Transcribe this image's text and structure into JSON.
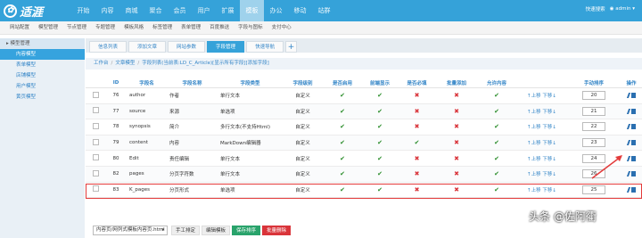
{
  "logo": {
    "text": "适涯"
  },
  "topnav": [
    "开始",
    "内容",
    "商城",
    "聚合",
    "会员",
    "用户",
    "扩展",
    "模板",
    "办公",
    "移动",
    "站群"
  ],
  "topnav_active": 7,
  "topright": {
    "quick": "快速搜索",
    "user": "admin"
  },
  "subbar": [
    "网站配置",
    "模型管理",
    "节点管理",
    "专题管理",
    "模板风格",
    "标签管理",
    "表单管理",
    "百度推送",
    "字段与图标",
    "支付中心"
  ],
  "sidebar": {
    "head": "模型管理",
    "items": [
      "内容模型",
      "表单模型",
      "店铺模型",
      "用户模型",
      "黄页模型"
    ],
    "active": 0
  },
  "tabs": [
    "信息列表",
    "添加文章",
    "网站参数",
    "字段管理",
    "快速导航"
  ],
  "tab_active": 3,
  "tab_plus": "+",
  "breadcrumb": [
    "工作台",
    "/",
    "文章模型",
    "/",
    "字段列表(当前表:LD_C_Article)[显示所有字段][添加字段]"
  ],
  "table": {
    "headers": [
      "",
      "ID",
      "字段名",
      "字段名称",
      "字段类型",
      "字段级别",
      "是否启用",
      "前端显示",
      "是否必填",
      "批量添加",
      "允许内容",
      "",
      "手动排序",
      "操作"
    ],
    "rows": [
      {
        "id": "76",
        "name": "author",
        "title": "作者",
        "type": "单行文本",
        "level": "自定义",
        "enabled": "ok",
        "front": "ok",
        "required": "no",
        "batch": "no",
        "allow": "ok",
        "sort": "↑上移 下移↓",
        "order": "20"
      },
      {
        "id": "77",
        "name": "source",
        "title": "来源",
        "type": "单选项",
        "level": "自定义",
        "enabled": "ok",
        "front": "ok",
        "required": "no",
        "batch": "no",
        "allow": "ok",
        "sort": "↑上移 下移↓",
        "order": "21"
      },
      {
        "id": "78",
        "name": "synopsis",
        "title": "简介",
        "type": "多行文本(不支持Html)",
        "level": "自定义",
        "enabled": "ok",
        "front": "ok",
        "required": "no",
        "batch": "no",
        "allow": "ok",
        "sort": "↑上移 下移↓",
        "order": "22"
      },
      {
        "id": "79",
        "name": "content",
        "title": "内容",
        "type": "MarkDown编辑器",
        "level": "自定义",
        "enabled": "ok",
        "front": "ok",
        "required": "ok",
        "batch": "no",
        "allow": "ok",
        "sort": "↑上移 下移↓",
        "order": "23"
      },
      {
        "id": "80",
        "name": "Edit",
        "title": "责任编辑",
        "type": "单行文本",
        "level": "自定义",
        "enabled": "ok",
        "front": "ok",
        "required": "no",
        "batch": "no",
        "allow": "ok",
        "sort": "↑上移 下移↓",
        "order": "24"
      },
      {
        "id": "82",
        "name": "pages",
        "title": "分页字符数",
        "type": "单行文本",
        "level": "自定义",
        "enabled": "ok",
        "front": "ok",
        "required": "no",
        "batch": "no",
        "allow": "ok",
        "sort": "↑上移 下移↓",
        "order": "26"
      },
      {
        "id": "83",
        "name": "K_pages",
        "title": "分页形式",
        "type": "单选项",
        "level": "自定义",
        "enabled": "ok",
        "front": "ok",
        "required": "no",
        "batch": "no",
        "allow": "ok",
        "sort": "↑上移 下移↓",
        "order": "25"
      }
    ]
  },
  "footer": {
    "select": "内容页/网列式模板内容页.html",
    "btn_manual": "手工排定",
    "btn_edit": "编辑模板",
    "btn_save": "保存排序",
    "btn_delete": "批量删除"
  },
  "watermark": "头条 @佐阿衢",
  "colors": {
    "header": "#35a2d9",
    "highlight": "#e33b3b",
    "ok": "#2b8d2b",
    "no": "#d9343a"
  }
}
